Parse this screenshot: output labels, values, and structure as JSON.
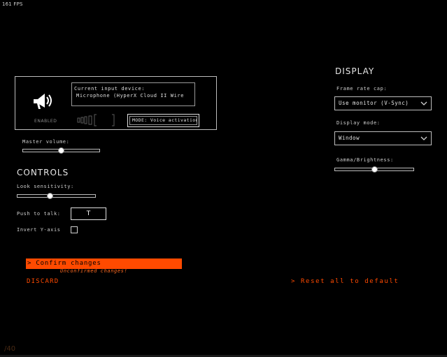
{
  "hud": {
    "fps": "161 FPS",
    "corner_text": "/40"
  },
  "voice": {
    "device_label": "Current input device:",
    "device_value": "Microphone (HyperX Cloud II Wire",
    "status": "ENABLED",
    "mode_label": "MODE: Voice activation",
    "icon": "megaphone-icon"
  },
  "audio": {
    "master_volume_label": "Master volume:",
    "master_volume_value": 0.5
  },
  "controls": {
    "heading": "CONTROLS",
    "look_sensitivity_label": "Look sensitivity:",
    "look_sensitivity_value": 0.42,
    "push_to_talk_label": "Push to talk:",
    "push_to_talk_key": "T",
    "invert_y_label": "Invert Y-axis",
    "invert_y_checked": false
  },
  "display": {
    "heading": "DISPLAY",
    "frame_rate_label": "Frame rate cap:",
    "frame_rate_value": "Use monitor (V-Sync)",
    "display_mode_label": "Display mode:",
    "display_mode_value": "Window",
    "gamma_label": "Gamma/Brightness:",
    "gamma_value": 0.5
  },
  "actions": {
    "confirm_label": "> Confirm changes",
    "unconfirmed_label": "Unconfirmed changes!",
    "discard_label": "DISCARD",
    "reset_label": "> Reset all to default"
  },
  "colors": {
    "accent": "#ff4a00",
    "background": "#000000",
    "text": "#d8d8d8"
  }
}
